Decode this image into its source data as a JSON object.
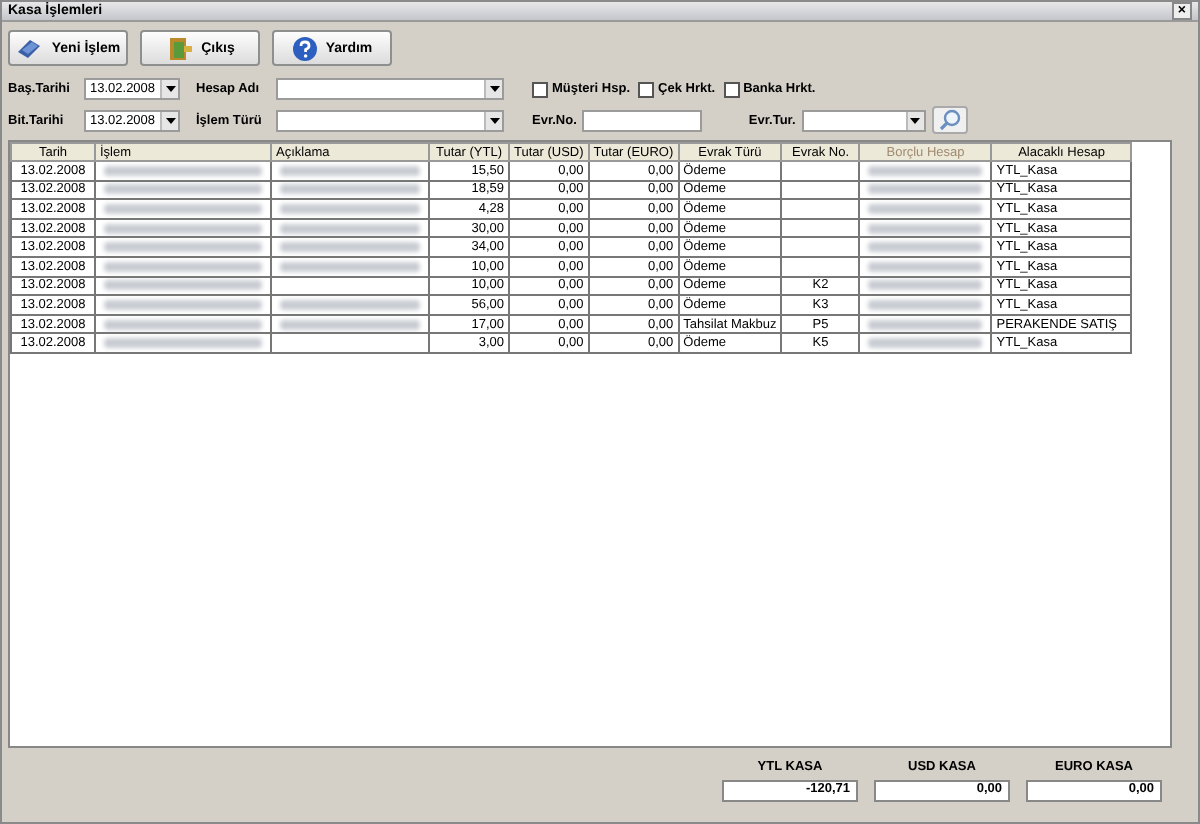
{
  "window": {
    "title": "Kasa İşlemleri",
    "close": "×"
  },
  "toolbar": [
    {
      "label": "Yeni İşlem",
      "kind": "new"
    },
    {
      "label": "Çıkış",
      "kind": "exit"
    },
    {
      "label": "Yardım",
      "kind": "help"
    }
  ],
  "filters": {
    "bas_tarihi": {
      "label": "Baş.Tarihi",
      "value": "13.02.2008"
    },
    "bit_tarihi": {
      "label": "Bit.Tarihi",
      "value": "13.02.2008"
    },
    "hesap_adi": {
      "label": "Hesap Adı"
    },
    "islem_turu": {
      "label": "İşlem Türü"
    },
    "evr_no": {
      "label": "Evr.No."
    },
    "evr_tur": {
      "label": "Evr.Tur."
    },
    "checks": [
      {
        "label": "Müşteri Hsp.",
        "checked": false
      },
      {
        "label": "Çek Hrkt.",
        "checked": false
      },
      {
        "label": "Banka Hrkt.",
        "checked": false
      }
    ]
  },
  "table": {
    "columns": [
      "Tarih",
      "İşlem",
      "Açıklama",
      "Tutar (YTL)",
      "Tutar (USD)",
      "Tutar (EURO)",
      "Evrak Türü",
      "Evrak No.",
      "Borçlu Hesap",
      "Alacaklı Hesap"
    ],
    "rows": [
      {
        "tarih": "13.02.2008",
        "islem_blurred": true,
        "aciklama_blurred": true,
        "ytl": "15,50",
        "usd": "0,00",
        "euro": "0,00",
        "evrak_turu": "Ödeme",
        "evrak_no": "",
        "borclu_blurred": true,
        "alacakli": "YTL_Kasa"
      },
      {
        "tarih": "13.02.2008",
        "islem_blurred": true,
        "aciklama_blurred": true,
        "ytl": "18,59",
        "usd": "0,00",
        "euro": "0,00",
        "evrak_turu": "Ödeme",
        "evrak_no": "",
        "borclu_blurred": true,
        "alacakli": "YTL_Kasa"
      },
      {
        "tarih": "13.02.2008",
        "islem_blurred": true,
        "aciklama_blurred": true,
        "ytl": "4,28",
        "usd": "0,00",
        "euro": "0,00",
        "evrak_turu": "Ödeme",
        "evrak_no": "",
        "borclu_blurred": true,
        "alacakli": "YTL_Kasa"
      },
      {
        "tarih": "13.02.2008",
        "islem_blurred": true,
        "aciklama_blurred": true,
        "ytl": "30,00",
        "usd": "0,00",
        "euro": "0,00",
        "evrak_turu": "Ödeme",
        "evrak_no": "",
        "borclu_blurred": true,
        "alacakli": "YTL_Kasa"
      },
      {
        "tarih": "13.02.2008",
        "islem_blurred": true,
        "aciklama_blurred": true,
        "ytl": "34,00",
        "usd": "0,00",
        "euro": "0,00",
        "evrak_turu": "Ödeme",
        "evrak_no": "",
        "borclu_blurred": true,
        "alacakli": "YTL_Kasa"
      },
      {
        "tarih": "13.02.2008",
        "islem_blurred": true,
        "aciklama_blurred": true,
        "ytl": "10,00",
        "usd": "0,00",
        "euro": "0,00",
        "evrak_turu": "Ödeme",
        "evrak_no": "",
        "borclu_blurred": true,
        "alacakli": "YTL_Kasa"
      },
      {
        "tarih": "13.02.2008",
        "islem_blurred": true,
        "aciklama_blurred": false,
        "ytl": "10,00",
        "usd": "0,00",
        "euro": "0,00",
        "evrak_turu": "Ödeme",
        "evrak_no": "K2",
        "borclu_blurred": true,
        "alacakli": "YTL_Kasa"
      },
      {
        "tarih": "13.02.2008",
        "islem_blurred": true,
        "aciklama_blurred": true,
        "ytl": "56,00",
        "usd": "0,00",
        "euro": "0,00",
        "evrak_turu": "Ödeme",
        "evrak_no": "K3",
        "borclu_blurred": true,
        "alacakli": "YTL_Kasa"
      },
      {
        "tarih": "13.02.2008",
        "islem_blurred": true,
        "aciklama_blurred": true,
        "ytl": "17,00",
        "usd": "0,00",
        "euro": "0,00",
        "evrak_turu": "Tahsilat Makbuz",
        "evrak_no": "P5",
        "borclu_blurred": true,
        "alacakli": "PERAKENDE SATIŞ"
      },
      {
        "tarih": "13.02.2008",
        "islem_blurred": true,
        "aciklama_blurred": false,
        "ytl": "3,00",
        "usd": "0,00",
        "euro": "0,00",
        "evrak_turu": "Ödeme",
        "evrak_no": "K5",
        "borclu_blurred": true,
        "alacakli": "YTL_Kasa"
      }
    ]
  },
  "totals": [
    {
      "label": "YTL KASA",
      "value": "-120,71"
    },
    {
      "label": "USD KASA",
      "value": "0,00"
    },
    {
      "label": "EURO KASA",
      "value": "0,00"
    }
  ]
}
